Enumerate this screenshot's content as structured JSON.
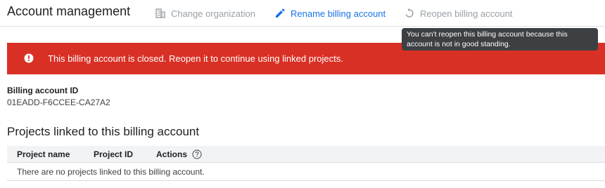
{
  "header": {
    "title": "Account management",
    "actions": {
      "change_organization": {
        "label": "Change organization",
        "icon": "building-icon",
        "state": "disabled"
      },
      "rename_billing_account": {
        "label": "Rename billing account",
        "icon": "pencil-icon",
        "state": "enabled"
      },
      "reopen_billing_account": {
        "label": "Reopen billing account",
        "icon": "refresh-icon",
        "state": "disabled"
      }
    }
  },
  "tooltip": {
    "line1": "You can't reopen this billing account because this",
    "line2": "account is not in good standing."
  },
  "banner": {
    "icon": "error-icon",
    "text": "This billing account is closed. Reopen it to continue using linked projects.",
    "color": "#d93025"
  },
  "billing_account": {
    "label": "Billing account ID",
    "value": "01EADD-F6CCEE-CA27A2"
  },
  "projects": {
    "title": "Projects linked to this billing account",
    "columns": {
      "project_name": "Project name",
      "project_id": "Project ID",
      "actions": "Actions"
    },
    "help_icon": "help-circle-icon",
    "empty_message": "There are no projects linked to this billing account."
  },
  "colors": {
    "primary": "#1a73e8",
    "disabled": "#9aa0a6",
    "error": "#d93025",
    "tooltip_bg": "#3c4043"
  }
}
